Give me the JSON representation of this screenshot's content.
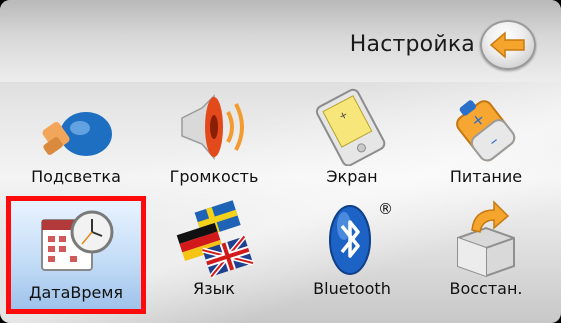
{
  "header": {
    "title": "Настройка"
  },
  "grid": {
    "items": [
      {
        "label": "Подсветка",
        "icon": "lightbulb-icon"
      },
      {
        "label": "Громкость",
        "icon": "speaker-icon"
      },
      {
        "label": "Экран",
        "icon": "pda-screen-icon"
      },
      {
        "label": "Питание",
        "icon": "battery-icon"
      },
      {
        "label": "ДатаВремя",
        "icon": "calendar-clock-icon",
        "selected": true
      },
      {
        "label": "Язык",
        "icon": "flags-icon"
      },
      {
        "label": "Bluetooth",
        "icon": "bluetooth-icon",
        "badge": "®"
      },
      {
        "label": "Восстан.",
        "icon": "restore-box-icon"
      }
    ]
  },
  "colors": {
    "selection_border": "#ff0a0a",
    "accent_orange": "#f7a631"
  }
}
